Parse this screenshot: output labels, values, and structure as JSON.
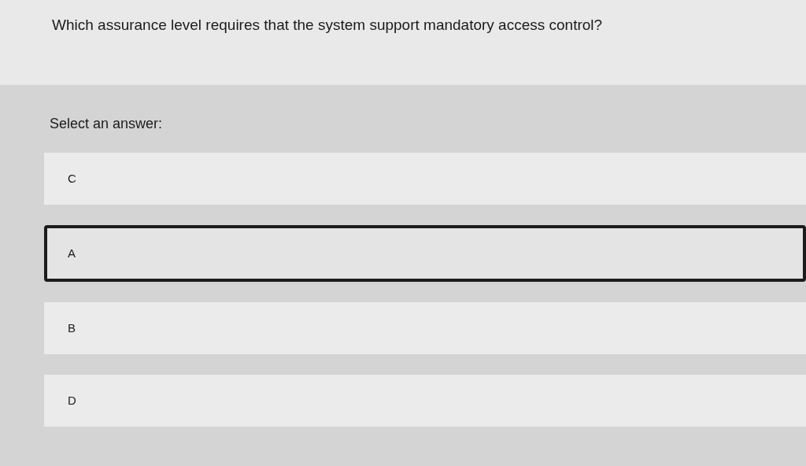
{
  "question": "Which assurance level requires that the system support mandatory access control?",
  "prompt": "Select an answer:",
  "options": [
    {
      "label": "C",
      "selected": false
    },
    {
      "label": "A",
      "selected": true
    },
    {
      "label": "B",
      "selected": false
    },
    {
      "label": "D",
      "selected": false
    }
  ]
}
